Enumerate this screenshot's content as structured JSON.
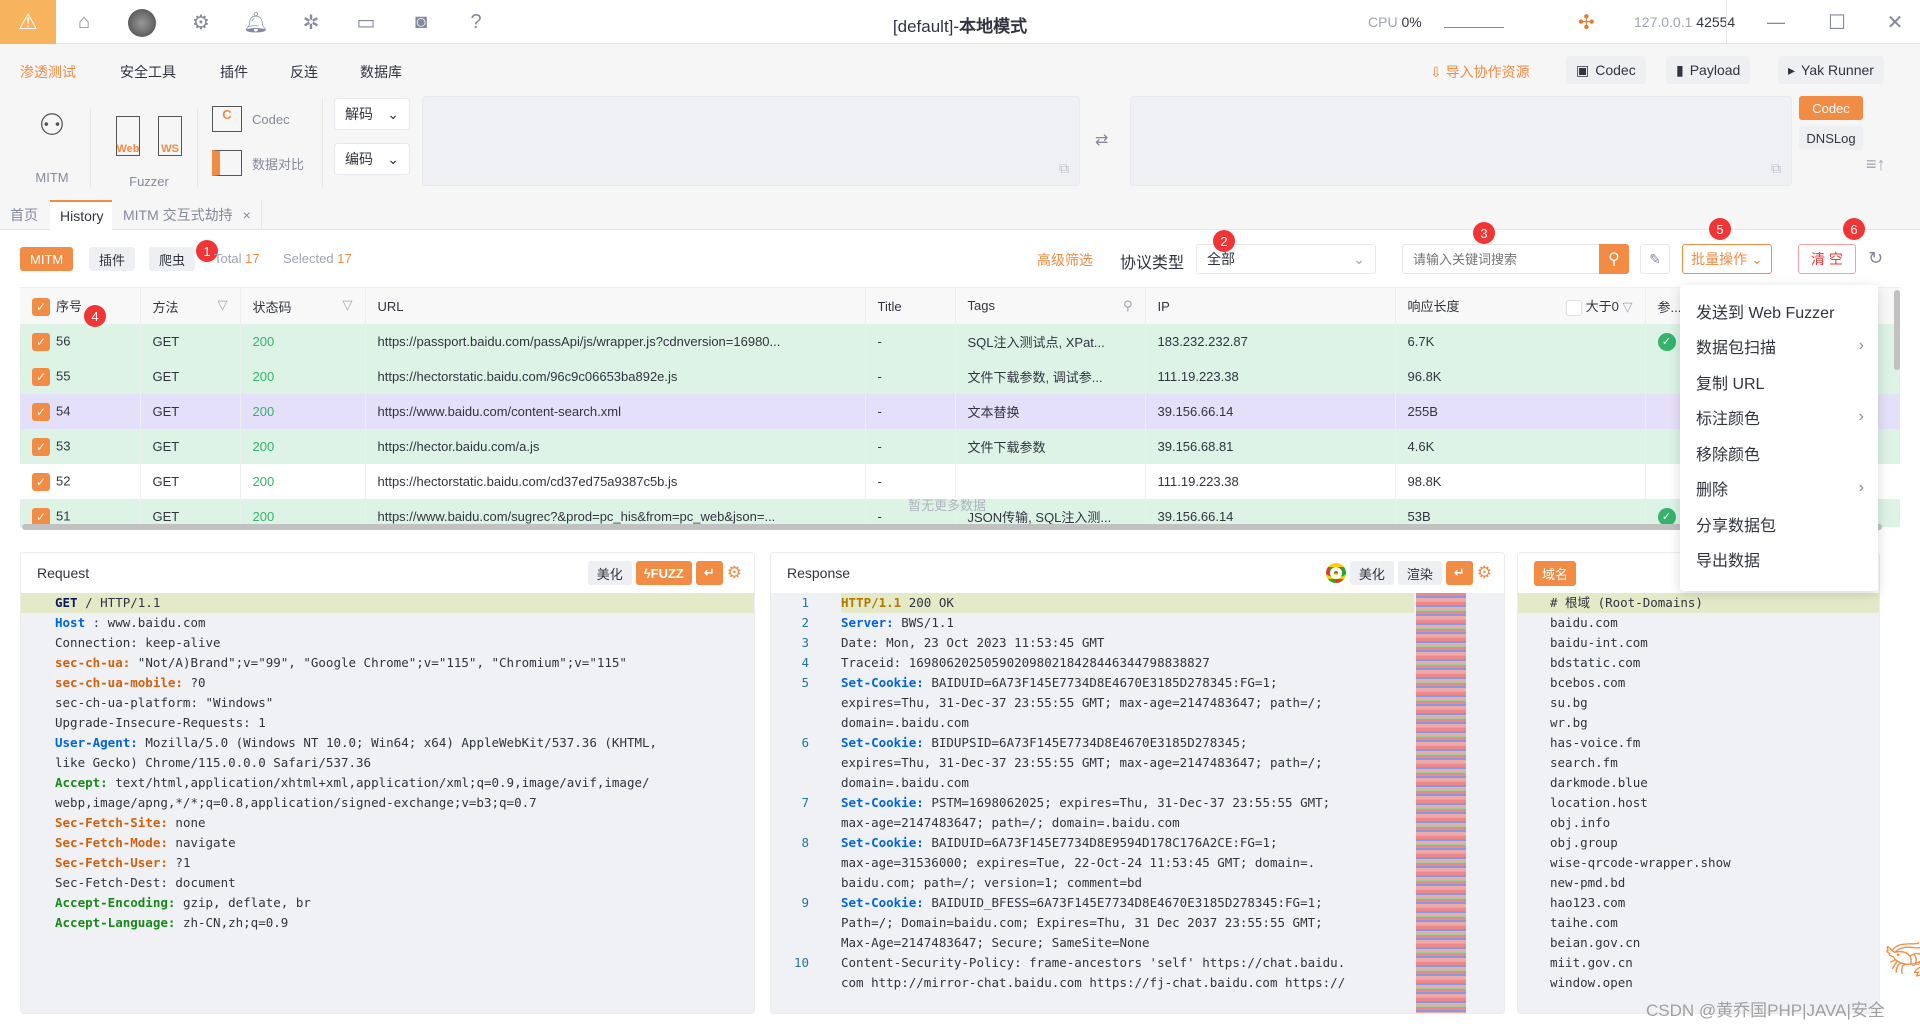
{
  "app": {
    "title_prefix": "[default]-",
    "title_mode": "本地模式",
    "cpu_label": "CPU",
    "cpu_value": "0%",
    "host": "127.0.0.1",
    "port": "42554",
    "accent": "#f28b44"
  },
  "top_icons": [
    "home-icon",
    "settings-icon",
    "bell-icon",
    "bug-icon",
    "terminal-icon",
    "camera-icon",
    "help-icon"
  ],
  "menu": {
    "items": [
      "渗透测试",
      "安全工具",
      "插件",
      "反连",
      "数据库"
    ],
    "import_label": "导入协作资源",
    "codec": "Codec",
    "payload": "Payload",
    "yak_runner": "Yak Runner"
  },
  "ribbon": {
    "mitm": "MITM",
    "fuzzer": "Fuzzer",
    "web": "Web",
    "ws": "WS",
    "codec": "Codec",
    "compare": "数据对比",
    "decode": "解码",
    "encode": "编码",
    "side_codec": "Codec",
    "side_dnslog": "DNSLog"
  },
  "tabs": [
    {
      "label": "首页"
    },
    {
      "label": "History"
    },
    {
      "label": "MITM 交互式劫持"
    }
  ],
  "filters": {
    "mitm": "MITM",
    "plugin": "插件",
    "crawler": "爬虫",
    "total_label": "Total",
    "total": "17",
    "selected_label": "Selected",
    "selected": "17",
    "advanced": "高级筛选",
    "protocol_label": "协议类型",
    "protocol_value": "全部",
    "search_placeholder": "请输入关键词搜索",
    "batch": "批量操作",
    "clear": "清 空",
    "badges": [
      "1",
      "2",
      "3",
      "4",
      "5",
      "6"
    ]
  },
  "table": {
    "columns": [
      "序号",
      "方法",
      "状态码",
      "URL",
      "Title",
      "Tags",
      "IP",
      "响应长度",
      "大于0",
      "参..."
    ],
    "rows": [
      {
        "id": "56",
        "method": "GET",
        "status": "200",
        "url": "https://passport.baidu.com/passApi/js/wrapper.js?cdnversion=16980...",
        "title": "-",
        "tags": "SQL注入测试点, XPat...",
        "ip": "183.232.232.87",
        "len": "6.7K",
        "color": "green",
        "param": true
      },
      {
        "id": "55",
        "method": "GET",
        "status": "200",
        "url": "https://hectorstatic.baidu.com/96c9c06653ba892e.js",
        "title": "-",
        "tags": "文件下载参数, 调试参...",
        "ip": "111.19.223.38",
        "len": "96.8K",
        "color": "green",
        "param": false
      },
      {
        "id": "54",
        "method": "GET",
        "status": "200",
        "url": "https://www.baidu.com/content-search.xml",
        "title": "-",
        "tags": "文本替换",
        "ip": "39.156.66.14",
        "len": "255B",
        "color": "purple",
        "param": false
      },
      {
        "id": "53",
        "method": "GET",
        "status": "200",
        "url": "https://hector.baidu.com/a.js",
        "title": "-",
        "tags": "文件下载参数",
        "ip": "39.156.68.81",
        "len": "4.6K",
        "color": "green",
        "param": false
      },
      {
        "id": "52",
        "method": "GET",
        "status": "200",
        "url": "https://hectorstatic.baidu.com/cd37ed75a9387c5b.js",
        "title": "-",
        "tags": "",
        "ip": "111.19.223.38",
        "len": "98.8K",
        "color": "white",
        "param": false
      },
      {
        "id": "51",
        "method": "GET",
        "status": "200",
        "url": "https://www.baidu.com/sugrec?&prod=pc_his&from=pc_web&json=...",
        "title": "-",
        "tags": "JSON传输, SQL注入测...",
        "ip": "39.156.66.14",
        "len": "53B",
        "color": "green",
        "param": true
      }
    ],
    "no_more": "暂无更多数据"
  },
  "batch_menu": [
    {
      "label": "发送到 Web Fuzzer",
      "sub": false
    },
    {
      "label": "数据包扫描",
      "sub": true
    },
    {
      "label": "复制 URL",
      "sub": false
    },
    {
      "label": "标注颜色",
      "sub": true
    },
    {
      "label": "移除颜色",
      "sub": false
    },
    {
      "label": "删除",
      "sub": true
    },
    {
      "label": "分享数据包",
      "sub": false
    },
    {
      "label": "导出数据",
      "sub": false
    }
  ],
  "request": {
    "title": "Request",
    "beautify": "美化",
    "fuzz": "FUZZ",
    "lines": [
      {
        "k": "GET",
        "c": "navy",
        "v": " / HTTP/1.1"
      },
      {
        "k": "Host",
        "c": "blue",
        "v": " : www.baidu.com"
      },
      {
        "k": "",
        "c": "",
        "v": "Connection: keep-alive"
      },
      {
        "k": "sec-ch-ua:",
        "c": "orange",
        "v": " \"Not/A)Brand\";v=\"99\", \"Google Chrome\";v=\"115\", \"Chromium\";v=\"115\""
      },
      {
        "k": "sec-ch-ua-mobile:",
        "c": "orange",
        "v": " ?0"
      },
      {
        "k": "",
        "c": "",
        "v": "sec-ch-ua-platform: \"Windows\""
      },
      {
        "k": "",
        "c": "",
        "v": "Upgrade-Insecure-Requests: 1"
      },
      {
        "k": "User-Agent:",
        "c": "blue",
        "v": " Mozilla/5.0 (Windows NT 10.0; Win64; x64) AppleWebKit/537.36 (KHTML,"
      },
      {
        "k": "",
        "c": "",
        "v": "like Gecko) Chrome/115.0.0.0 Safari/537.36"
      },
      {
        "k": "Accept:",
        "c": "green",
        "v": " text/html,application/xhtml+xml,application/xml;q=0.9,image/avif,image/"
      },
      {
        "k": "",
        "c": "",
        "v": "webp,image/apng,*/*;q=0.8,application/signed-exchange;v=b3;q=0.7"
      },
      {
        "k": "Sec-Fetch-Site:",
        "c": "orange",
        "v": " none"
      },
      {
        "k": "Sec-Fetch-Mode:",
        "c": "orange",
        "v": " navigate"
      },
      {
        "k": "Sec-Fetch-User:",
        "c": "orange",
        "v": " ?1"
      },
      {
        "k": "",
        "c": "",
        "v": "Sec-Fetch-Dest: document"
      },
      {
        "k": "Accept-Encoding:",
        "c": "green",
        "v": " gzip, deflate, br"
      },
      {
        "k": "Accept-Language:",
        "c": "green",
        "v": " zh-CN,zh;q=0.9"
      }
    ]
  },
  "response": {
    "title": "Response",
    "beautify": "美化",
    "render": "渲染",
    "lines": [
      {
        "n": "1",
        "k": "HTTP/1.1",
        "c": "brown",
        "v": " 200 OK"
      },
      {
        "n": "2",
        "k": "Server:",
        "c": "blue",
        "v": " BWS/1.1"
      },
      {
        "n": "3",
        "k": "",
        "c": "",
        "v": "Date: Mon, 23 Oct 2023 11:53:45 GMT"
      },
      {
        "n": "4",
        "k": "",
        "c": "",
        "v": "Traceid: 1698062025059020980218428446344798838827"
      },
      {
        "n": "5",
        "k": "Set-Cookie:",
        "c": "blue",
        "v": " BAIDUID=6A73F145E7734D8E4670E3185D278345:FG=1;"
      },
      {
        "n": "",
        "k": "",
        "c": "",
        "v": "expires=Thu, 31-Dec-37 23:55:55 GMT; max-age=2147483647; path=/;"
      },
      {
        "n": "",
        "k": "",
        "c": "",
        "v": "domain=.baidu.com"
      },
      {
        "n": "6",
        "k": "Set-Cookie:",
        "c": "blue",
        "v": " BIDUPSID=6A73F145E7734D8E4670E3185D278345;"
      },
      {
        "n": "",
        "k": "",
        "c": "",
        "v": "expires=Thu, 31-Dec-37 23:55:55 GMT; max-age=2147483647; path=/;"
      },
      {
        "n": "",
        "k": "",
        "c": "",
        "v": "domain=.baidu.com"
      },
      {
        "n": "7",
        "k": "Set-Cookie:",
        "c": "blue",
        "v": " PSTM=1698062025; expires=Thu, 31-Dec-37 23:55:55 GMT;"
      },
      {
        "n": "",
        "k": "",
        "c": "",
        "v": "max-age=2147483647; path=/; domain=.baidu.com"
      },
      {
        "n": "8",
        "k": "Set-Cookie:",
        "c": "blue",
        "v": " BAIDUID=6A73F145E7734D8E9594D178C176A2CE:FG=1;"
      },
      {
        "n": "",
        "k": "",
        "c": "",
        "v": "max-age=31536000; expires=Tue, 22-Oct-24 11:53:45 GMT; domain=."
      },
      {
        "n": "",
        "k": "",
        "c": "",
        "v": "baidu.com; path=/; version=1; comment=bd"
      },
      {
        "n": "9",
        "k": "Set-Cookie:",
        "c": "blue",
        "v": " BAIDUID_BFESS=6A73F145E7734D8E4670E3185D278345:FG=1;"
      },
      {
        "n": "",
        "k": "",
        "c": "",
        "v": "Path=/; Domain=baidu.com; Expires=Thu, 31 Dec 2037 23:55:55 GMT;"
      },
      {
        "n": "",
        "k": "",
        "c": "",
        "v": "Max-Age=2147483647; Secure; SameSite=None"
      },
      {
        "n": "10",
        "k": "",
        "c": "",
        "v": "Content-Security-Policy: frame-ancestors 'self' https://chat.baidu."
      },
      {
        "n": "",
        "k": "",
        "c": "",
        "v": "com http://mirror-chat.baidu.com https://fj-chat.baidu.com https://"
      }
    ]
  },
  "domains": {
    "tab": "域名",
    "lines": [
      "# 根域 (Root-Domains)",
      "baidu.com",
      "baidu-int.com",
      "bdstatic.com",
      "bcebos.com",
      "su.bg",
      "wr.bg",
      "has-voice.fm",
      "search.fm",
      "darkmode.blue",
      "location.host",
      "obj.info",
      "obj.group",
      "wise-qrcode-wrapper.show",
      "new-pmd.bd",
      "hao123.com",
      "taihe.com",
      "beian.gov.cn",
      "miit.gov.cn",
      "window.open"
    ]
  },
  "watermark": "CSDN @黄乔国PHP|JAVA|安全"
}
